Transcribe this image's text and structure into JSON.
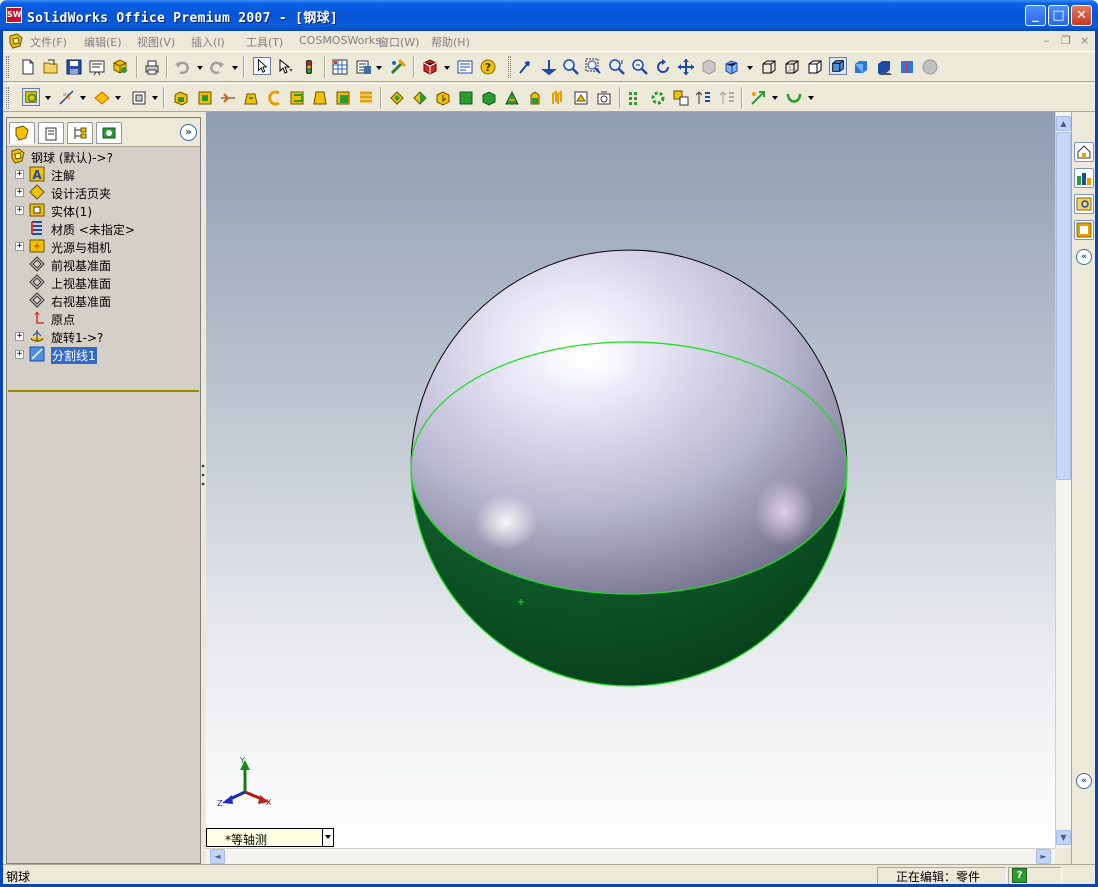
{
  "window": {
    "title": "SolidWorks Office Premium 2007 - [钢球]",
    "app_logo_text": "SW",
    "minimize": "_",
    "maximize": "□",
    "close": "✕"
  },
  "menu": {
    "items": [
      "文件(F)",
      "编辑(E)",
      "视图(V)",
      "插入(I)",
      "工具(T)",
      "COSMOSWorks",
      "窗口(W)",
      "帮助(H)"
    ],
    "mdi_minimize": "–",
    "mdi_restore": "❐",
    "mdi_close": "×"
  },
  "panel": {
    "expand_symbol": "»",
    "tree": {
      "root": "钢球    (默认)->?",
      "items": [
        {
          "label": "注解",
          "expand": "+"
        },
        {
          "label": "设计活页夹",
          "expand": "+"
        },
        {
          "label": "实体(1)",
          "expand": "+"
        },
        {
          "label": "材质 <未指定>",
          "expand": ""
        },
        {
          "label": "光源与相机",
          "expand": "+"
        },
        {
          "label": "前视基准面",
          "expand": ""
        },
        {
          "label": "上视基准面",
          "expand": ""
        },
        {
          "label": "右视基准面",
          "expand": ""
        },
        {
          "label": "原点",
          "expand": ""
        },
        {
          "label": "旋转1->?",
          "expand": "+"
        },
        {
          "label": "分割线1",
          "expand": "+"
        }
      ]
    }
  },
  "viewport": {
    "triad": {
      "x": "X",
      "y": "Y",
      "z": "Z"
    },
    "view_orientation": "*等轴测",
    "colors": {
      "upper_face": "#c9c8e0",
      "lower_face": "#0e5a2a",
      "split_line": "#22dd22"
    }
  },
  "taskpane": {
    "collapse_symbol": "«"
  },
  "status": {
    "left": "钢球",
    "right": "正在编辑：零件",
    "help": "?"
  },
  "scroll": {
    "up": "▲",
    "down": "▼",
    "left": "◄",
    "right": "►"
  }
}
